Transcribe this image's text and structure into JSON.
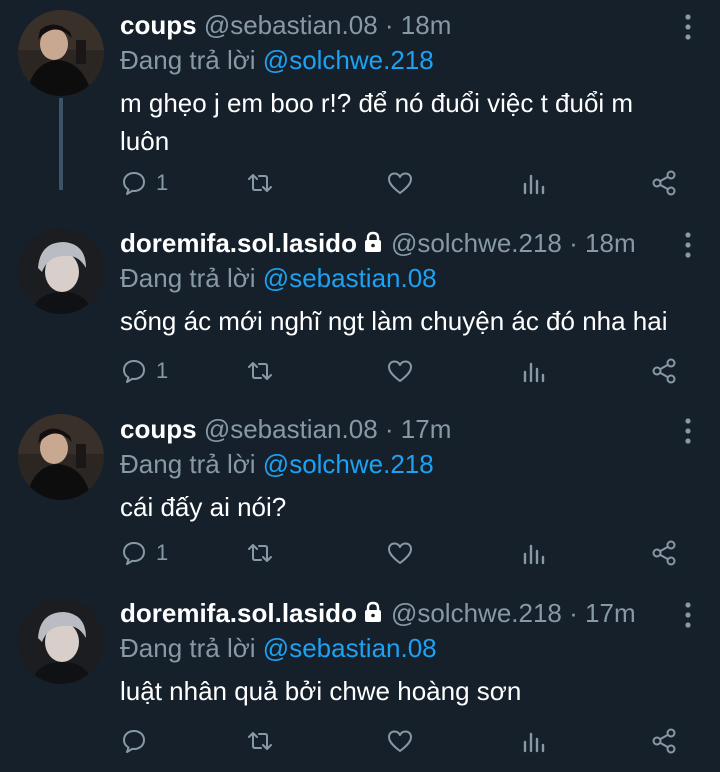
{
  "tweets": [
    {
      "name": "coups",
      "handle": "@sebastian.08",
      "time": "18m",
      "reply_prefix": "Đang trả lời",
      "reply_to": "@solchwe.218",
      "text": "m ghẹo j em boo r!? để nó đuổi việc t đuổi m luôn",
      "reply_count": "1",
      "locked": false,
      "avatar": "dark"
    },
    {
      "name": "doremifa.sol.lasido",
      "handle": "@solchwe.218",
      "time": "18m",
      "reply_prefix": "Đang trả lời",
      "reply_to": "@sebastian.08",
      "text": "sống ác mới nghĩ ngt làm chuyện ác đó nha hai",
      "reply_count": "1",
      "locked": true,
      "avatar": "silver"
    },
    {
      "name": "coups",
      "handle": "@sebastian.08",
      "time": "17m",
      "reply_prefix": "Đang trả lời",
      "reply_to": "@solchwe.218",
      "text": "cái đấy ai nói?",
      "reply_count": "1",
      "locked": false,
      "avatar": "dark"
    },
    {
      "name": "doremifa.sol.lasido",
      "handle": "@solchwe.218",
      "time": "17m",
      "reply_prefix": "Đang trả lời",
      "reply_to": "@sebastian.08",
      "text": "luật nhân quả bởi chwe hoàng sơn",
      "reply_count": "",
      "locked": true,
      "avatar": "silver"
    }
  ],
  "separator": "·",
  "icons": {
    "reply": "reply-icon",
    "retweet": "retweet-icon",
    "like": "heart-icon",
    "analytics": "analytics-icon",
    "share": "share-icon",
    "more": "more-vertical-icon",
    "lock": "lock-icon"
  },
  "colors": {
    "background": "#15202b",
    "muted": "#8899a6",
    "mention": "#1da1f2",
    "thread_line": "#3d5466"
  }
}
